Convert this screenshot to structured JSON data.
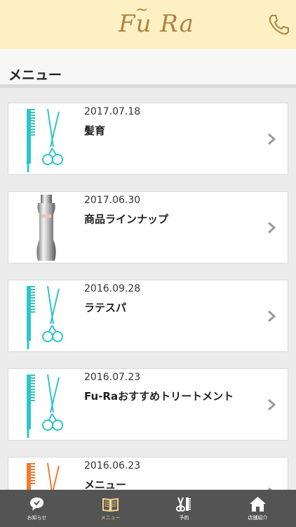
{
  "header": {
    "logo_text": "Fu Ra",
    "logo_tilde": "~",
    "phone_icon": "phone-icon"
  },
  "section": {
    "title": "メニュー"
  },
  "items": [
    {
      "date": "2017.07.18",
      "title": "髪育",
      "thumb": "comb-scissors-icon"
    },
    {
      "date": "2017.06.30",
      "title": "商品ラインナップ",
      "thumb": "product-bottle-image"
    },
    {
      "date": "2016.09.28",
      "title": "ラテスパ",
      "thumb": "comb-scissors-icon"
    },
    {
      "date": "2016.07.23",
      "title": "Fu-Raおすすめトリートメント",
      "thumb": "comb-scissors-icon"
    },
    {
      "date": "2016.06.23",
      "title": "メニュー",
      "thumb": "comb-scissors-icon-orange"
    }
  ],
  "tabs": [
    {
      "label": "お知らせ",
      "icon": "chat-bubble-icon"
    },
    {
      "label": "メニュー",
      "icon": "book-icon",
      "active": true
    },
    {
      "label": "予約",
      "icon": "scissors-comb-icon"
    },
    {
      "label": "店舗紹介",
      "icon": "home-icon"
    }
  ],
  "colors": {
    "header_bg": "#fdf1c4",
    "brand": "#b0813f",
    "teal": "#2ec4c8",
    "orange": "#ef7a33",
    "tabbar_bg": "#545454",
    "tab_active": "#f2d28a"
  }
}
